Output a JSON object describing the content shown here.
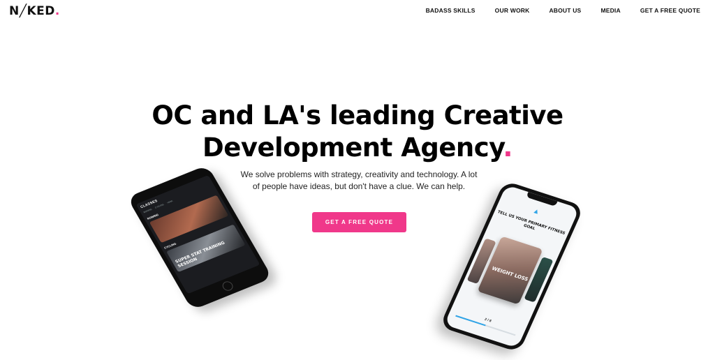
{
  "header": {
    "logo_main": "N╱KED",
    "logo_dot": ".",
    "nav": [
      {
        "label": "BADASS SKILLS"
      },
      {
        "label": "OUR WORK"
      },
      {
        "label": "ABOUT US"
      },
      {
        "label": "MEDIA"
      },
      {
        "label": "GET A FREE QUOTE"
      }
    ]
  },
  "hero": {
    "title_line1": "OC and LA's leading Creative",
    "title_line2": "Development Agency",
    "title_dot": ".",
    "subtitle": "We solve problems with strategy, creativity and technology. A lot of people have ideas, but don't have a clue. We can help.",
    "cta_label": "GET A FREE QUOTE"
  },
  "phone_left": {
    "header": "CLASSES",
    "tabs": [
      "ROWING",
      "CYCLING",
      "YOGA"
    ],
    "section1": "ROWING",
    "section2": "CYCLING",
    "card_label": "SUPER STAT TRAINING SESSION"
  },
  "phone_right": {
    "heading": "TELL US YOUR PRIMARY FITNESS GOAL",
    "card_label": "WEIGHT LOSS",
    "step": "2 / 8",
    "progress": 0.5
  },
  "colors": {
    "accent": "#f0388a",
    "app_blue": "#2fa4e7"
  }
}
